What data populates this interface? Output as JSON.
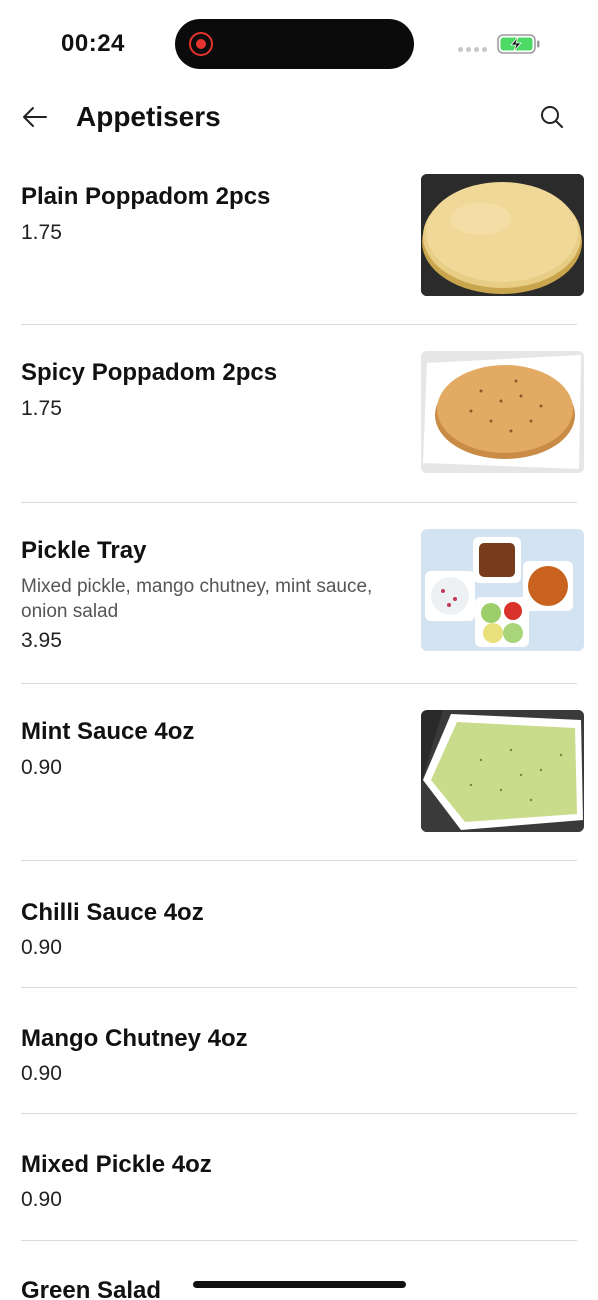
{
  "status_bar": {
    "time": "00:24",
    "recording_indicator": "red-record-dot",
    "battery_state": "charging",
    "battery_color": "#4cd964"
  },
  "header": {
    "back_icon": "arrow-left-icon",
    "title": "Appetisers",
    "search_icon": "search-icon"
  },
  "menu_items": [
    {
      "name": "Plain Poppadom 2pcs",
      "description": "",
      "price": "1.75",
      "has_image": true,
      "image": "plain-poppadom-photo"
    },
    {
      "name": "Spicy Poppadom 2pcs",
      "description": "",
      "price": "1.75",
      "has_image": true,
      "image": "spicy-poppadom-photo"
    },
    {
      "name": "Pickle Tray",
      "description": "Mixed pickle, mango chutney, mint sauce, onion salad",
      "price": "3.95",
      "has_image": true,
      "image": "pickle-tray-photo"
    },
    {
      "name": "Mint Sauce 4oz",
      "description": "",
      "price": "0.90",
      "has_image": true,
      "image": "mint-sauce-photo"
    },
    {
      "name": "Chilli Sauce 4oz",
      "description": "",
      "price": "0.90",
      "has_image": false
    },
    {
      "name": "Mango Chutney 4oz",
      "description": "",
      "price": "0.90",
      "has_image": false
    },
    {
      "name": "Mixed Pickle 4oz",
      "description": "",
      "price": "0.90",
      "has_image": false
    },
    {
      "name": "Green Salad",
      "description": "",
      "price": "",
      "has_image": false
    }
  ]
}
